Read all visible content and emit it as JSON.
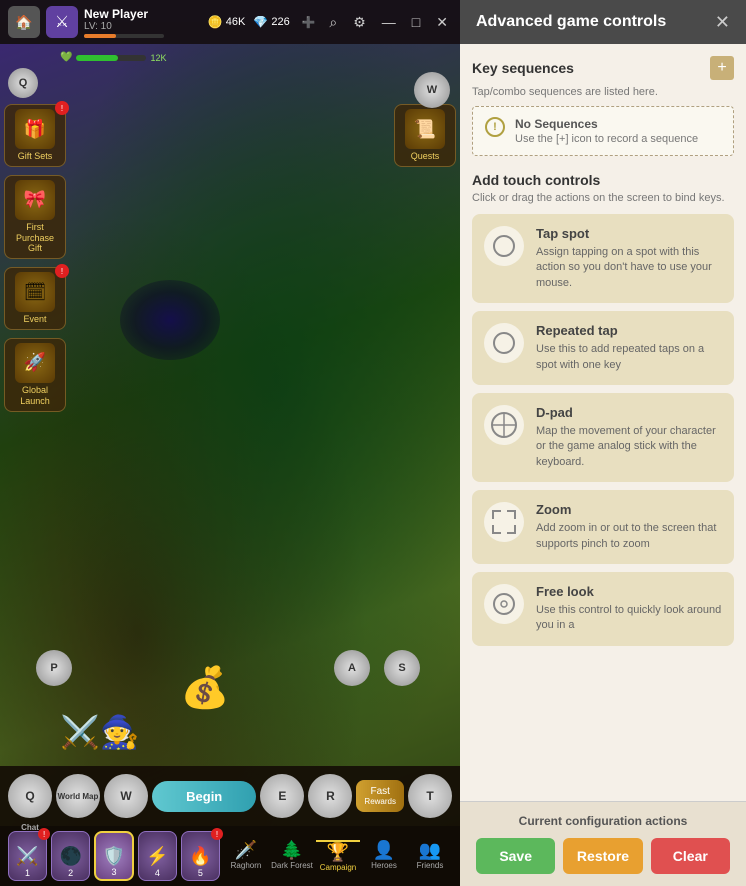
{
  "app": {
    "title": "Advanced game controls",
    "close_label": "✕"
  },
  "top_bar": {
    "player_name": "New Player",
    "level": "LV: 10",
    "gold": "46K",
    "gems": "226",
    "hp_label": "12K",
    "buttons": {
      "search": "⌕",
      "settings": "⚙",
      "minimize": "—",
      "maximize": "□",
      "close": "✕"
    }
  },
  "side_menu_left": [
    {
      "label": "Gift Sets",
      "icon": "🎁",
      "has_badge": true
    },
    {
      "label": "First Purchase\nGift",
      "icon": "🎀",
      "has_badge": false
    },
    {
      "label": "Event",
      "icon": "🗓",
      "has_badge": true
    },
    {
      "label": "Global Launch",
      "icon": "🚀",
      "has_badge": false
    }
  ],
  "side_menu_right": [
    {
      "label": "Quests",
      "icon": "📜",
      "has_badge": false
    }
  ],
  "float_buttons": {
    "w": "W",
    "q": "Q"
  },
  "action_bar": {
    "begin_label": "Begin",
    "fast_label": "Fast",
    "fast_sublabel": "Rewards",
    "keys": [
      "Q",
      "W",
      "E",
      "R",
      "T"
    ]
  },
  "skills": [
    {
      "num": "1",
      "icon": "⚔️",
      "selected": false,
      "has_exclaim": true
    },
    {
      "num": "2",
      "icon": "🌑",
      "selected": false,
      "has_exclaim": false
    },
    {
      "num": "3",
      "icon": "🛡️",
      "selected": true,
      "has_exclaim": false
    },
    {
      "num": "4",
      "icon": "⚡",
      "selected": false,
      "has_exclaim": false
    },
    {
      "num": "5",
      "icon": "🔥",
      "selected": false,
      "has_exclaim": true
    }
  ],
  "bottom_nav": [
    "Raghorn",
    "Dark Forest",
    "Campaign",
    "Heroes",
    "Friends"
  ],
  "panel": {
    "title": "Advanced game controls",
    "key_sequences": {
      "title": "Key sequences",
      "desc": "Tap/combo sequences are listed here.",
      "no_sequences_title": "No Sequences",
      "no_sequences_desc": "Use the [+] icon to record a sequence",
      "add_label": "+"
    },
    "touch_controls": {
      "title": "Add touch controls",
      "desc": "Click or drag the actions on the screen to bind keys.",
      "controls": [
        {
          "name": "Tap spot",
          "desc": "Assign tapping on a spot with this action so you don't have to use your mouse.",
          "icon": "○"
        },
        {
          "name": "Repeated tap",
          "desc": "Use this to add repeated taps on a spot with one key",
          "icon": "○"
        },
        {
          "name": "D-pad",
          "desc": "Map the movement of your character or the game analog stick with the keyboard.",
          "icon": "⊕"
        },
        {
          "name": "Zoom",
          "desc": "Add zoom in or out to the screen that supports pinch to zoom",
          "icon": "⤢"
        },
        {
          "name": "Free look",
          "desc": "Use this control to quickly look around you in a",
          "icon": "◎"
        }
      ]
    },
    "footer": {
      "label": "Current configuration actions",
      "save_label": "Save",
      "restore_label": "Restore",
      "clear_label": "Clear"
    }
  }
}
